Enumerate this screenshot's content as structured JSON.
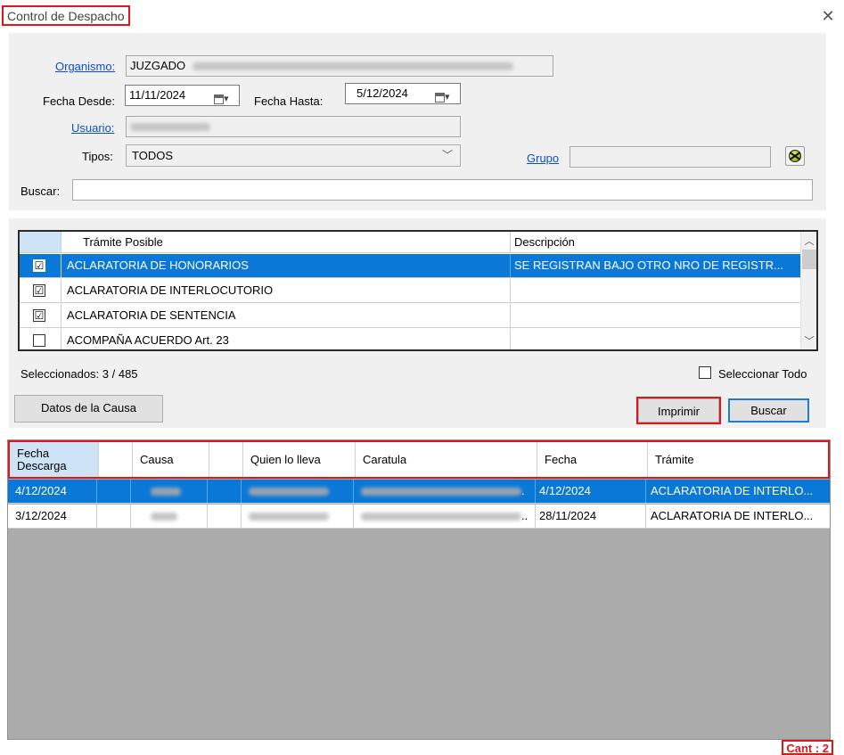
{
  "window": {
    "title": "Control de Despacho",
    "close_glyph": "✕"
  },
  "form": {
    "organismo_label": "Organismo:",
    "organismo_value": "JUZGADO",
    "fecha_desde_label": "Fecha Desde:",
    "fecha_desde_value": "11/11/2024",
    "fecha_hasta_label": "Fecha Hasta:",
    "fecha_hasta_value": "5/12/2024",
    "usuario_label": "Usuario:",
    "tipos_label": "Tipos:",
    "tipos_value": "TODOS",
    "grupo_label": "Grupo",
    "buscar_label": "Buscar:",
    "buscar_value": ""
  },
  "tramites": {
    "col_tramite": "Trámite Posible",
    "col_descripcion": "Descripción",
    "rows": [
      {
        "checked": "☑",
        "name": "ACLARATORIA DE HONORARIOS",
        "desc": "SE REGISTRAN BAJO OTRO NRO DE REGISTR..."
      },
      {
        "checked": "☑",
        "name": "ACLARATORIA DE INTERLOCUTORIO",
        "desc": ""
      },
      {
        "checked": "☑",
        "name": "ACLARATORIA DE SENTENCIA",
        "desc": ""
      },
      {
        "checked": "",
        "name": "ACOMPAÑA ACUERDO Art. 23",
        "desc": ""
      }
    ],
    "selected_count": "Seleccionados: 3 / 485",
    "select_all_label": "Seleccionar Todo"
  },
  "buttons": {
    "datos_causa": "Datos de la Causa",
    "imprimir": "Imprimir",
    "buscar": "Buscar"
  },
  "results": {
    "headers": [
      "Fecha Descarga",
      "",
      "Causa",
      "",
      "Quien lo lleva",
      "Caratula",
      "Fecha",
      "Trámite"
    ],
    "rows": [
      {
        "fecha_descarga": "4/12/2024",
        "caratula_tail": ".",
        "fecha": "4/12/2024",
        "tramite": "ACLARATORIA DE INTERLO..."
      },
      {
        "fecha_descarga": "3/12/2024",
        "caratula_tail": "..",
        "fecha": "28/11/2024",
        "tramite": "ACLARATORIA DE INTERLO..."
      }
    ],
    "count_label": "Cant : 2"
  },
  "colors": {
    "accent": "#0a78d7",
    "highlight": "#e0161b",
    "link": "#0a4fd1"
  },
  "icons": {
    "close": "close-icon",
    "calendar": "calendar-icon",
    "combo": "chevron-down-icon",
    "grupo": "group-search-icon"
  }
}
